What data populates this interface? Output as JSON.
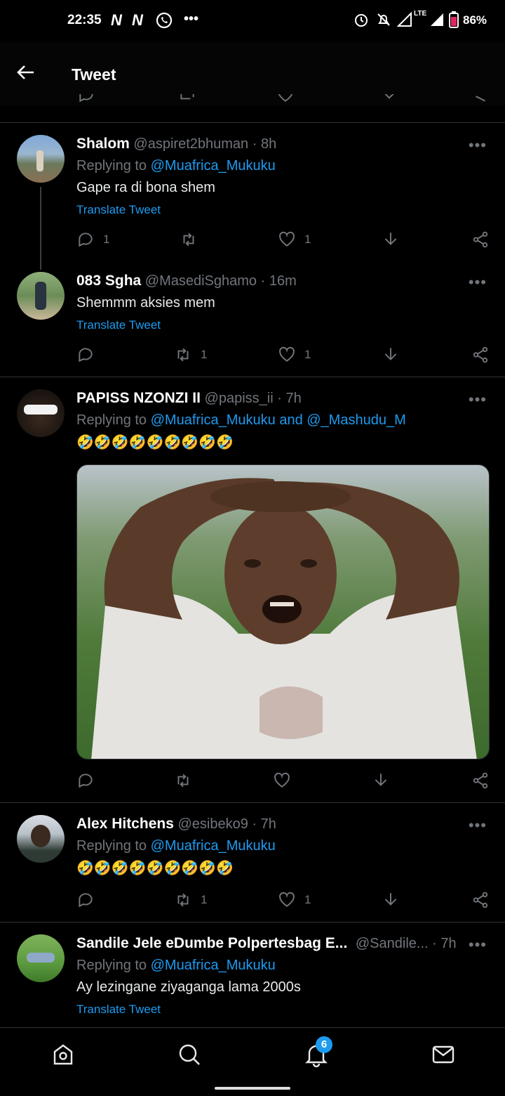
{
  "status_bar": {
    "time": "22:35",
    "n1": "N",
    "n2": "N",
    "dots": "•••",
    "lte": "LTE",
    "battery": "86%"
  },
  "header": {
    "title": "Tweet"
  },
  "tweets": [
    {
      "name": "Shalom",
      "handle": "@aspiret2bhuman",
      "sep": "·",
      "time": "8h",
      "replying_prefix": "Replying to",
      "replying_to": "@Muafrica_Mukuku",
      "text": "Gape ra di bona shem",
      "translate": "Translate Tweet",
      "reply_count": "1",
      "retweet_count": "",
      "like_count": "1"
    },
    {
      "name": "083 Sgha",
      "handle": "@MasediSghamo",
      "sep": "·",
      "time": "16m",
      "text": "Shemmm aksies mem",
      "translate": "Translate Tweet",
      "reply_count": "",
      "retweet_count": "1",
      "like_count": "1"
    },
    {
      "name": "PAPISS NZONZI II",
      "handle": "@papiss_ii",
      "sep": "·",
      "time": "7h",
      "replying_prefix": "Replying to",
      "replying_to": "@Muafrica_Mukuku and @_Mashudu_M",
      "emoji": "🤣🤣🤣🤣🤣🤣🤣🤣🤣",
      "reply_count": "",
      "retweet_count": "",
      "like_count": ""
    },
    {
      "name": "Alex Hitchens",
      "handle": "@esibeko9",
      "sep": "·",
      "time": "7h",
      "replying_prefix": "Replying to",
      "replying_to": "@Muafrica_Mukuku",
      "emoji": "🤣🤣🤣🤣🤣🤣🤣🤣🤣",
      "reply_count": "",
      "retweet_count": "1",
      "like_count": "1"
    },
    {
      "name": "Sandile Jele eDumbe Polpertesbag E...",
      "handle": "@Sandile...",
      "sep": "·",
      "time": "7h",
      "replying_prefix": "Replying to",
      "replying_to": "@Muafrica_Mukuku",
      "text": "Ay lezingane ziyaganga lama 2000s",
      "translate": "Translate Tweet"
    }
  ],
  "more_label": "•••",
  "bottom_nav": {
    "notifications_badge": "6"
  },
  "colors": {
    "accent": "#1d9bf0",
    "muted": "#71767b",
    "background": "#000000"
  }
}
